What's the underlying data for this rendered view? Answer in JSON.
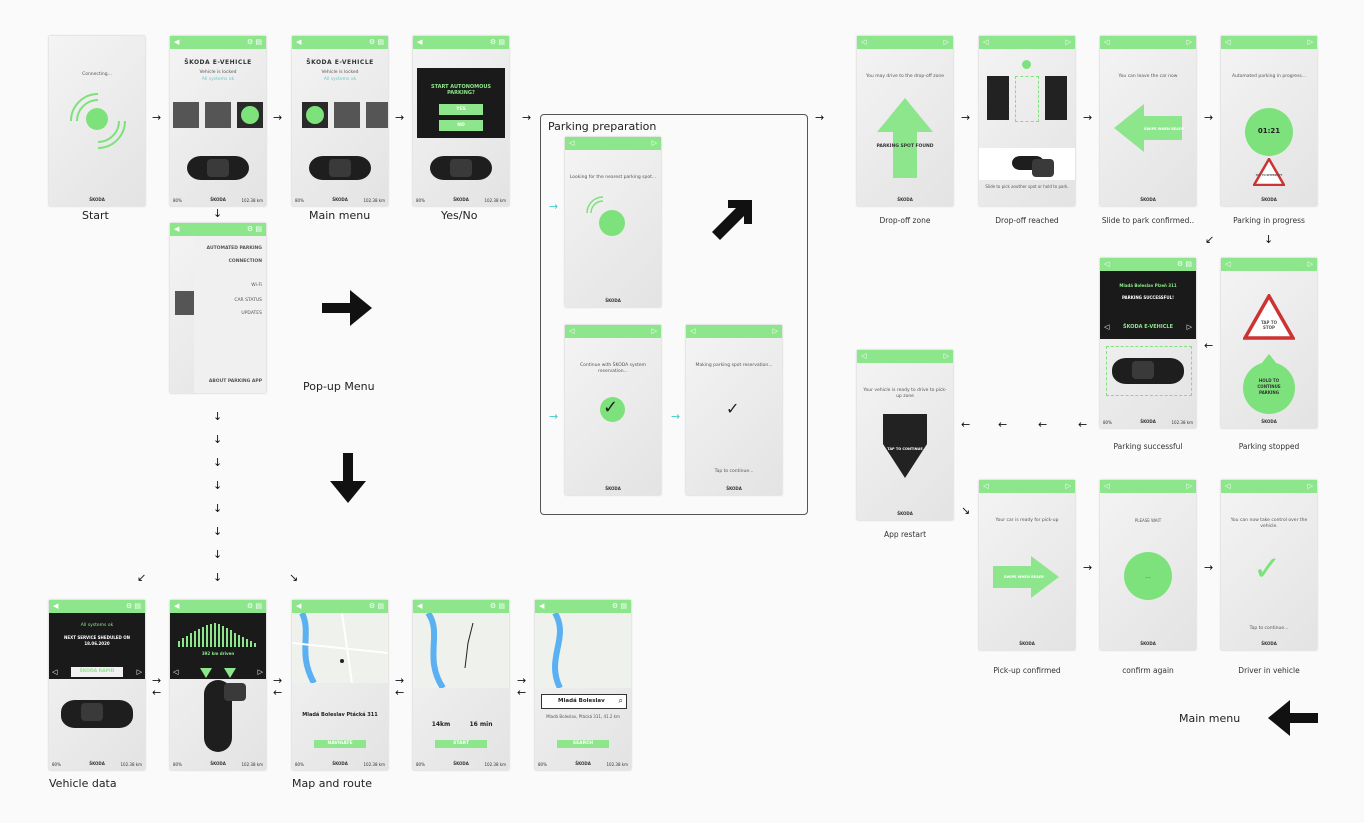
{
  "labels": {
    "start": "Start",
    "main_menu": "Main menu",
    "yes_no": "Yes/No",
    "popup_menu": "Pop-up Menu",
    "parking_preparation": "Parking preparation",
    "vehicle_data": "Vehicle data",
    "map_and_route": "Map and route",
    "main_menu_return": "Main menu",
    "drop_off_zone": "Drop-off zone",
    "drop_off_reached": "Drop-off reached",
    "slide_to_park": "Slide to park confirmed..",
    "parking_in_progress": "Parking in progress",
    "parking_successful": "Parking successful",
    "parking_stopped": "Parking stopped",
    "app_restart": "App restart",
    "pickup_confirmed": "Pick-up confirmed",
    "confirm_again": "confirm again",
    "driver_in_vehicle": "Driver in vehicle"
  },
  "screens": {
    "brand": "ŠKODA E-VEHICLE",
    "logo": "ŠKODA",
    "connecting": "Connecting...",
    "locked": "Vehicle is locked",
    "systems_ok": "All systems ok",
    "foot_left": "80%",
    "foot_right": "102.38 km",
    "start_autonomous": "START AUTONOMOUS PARKING?",
    "yes": "YES",
    "no": "NO",
    "menu_items": [
      "AUTOMATED PARKING",
      "CONNECTION",
      "Wi-Fi",
      "CAR STATUS",
      "UPDATES",
      "ABOUT PARKING APP"
    ],
    "looking": "Looking for the nearest parking spot...",
    "continue_reservation": "Continue with ŠKODA system reservation...",
    "making_reservation": "Making parking spot reservation...",
    "tap_continue": "Tap to continue...",
    "drive_to_dropoff": "You may drive to the drop-off zone",
    "parking_spot_found": "PARKING SPOT FOUND",
    "slide_to_pick": "Slide to pick another spot or hold to park.",
    "can_leave": "You can leave the car now",
    "swipe_ready": "SWIPE WHEN READY",
    "automated_in_progress": "Automated parking in progress...",
    "timer": "01:21",
    "tap_to_interrupt": "TAP TO INTERRUPT",
    "tap_to_stop": "TAP TO STOP",
    "hold_to_continue": "HOLD TO CONTINUE PARKING",
    "parking_place": "Mladá Boleslav Plzeň 311",
    "parking_successful": "PARKING SUCCESSFUL!",
    "ready_to_drive": "Your vehicle is ready to drive to pick-up zone",
    "tap_to_continue_big": "TAP TO CONTINUE",
    "ready_for_pickup": "Your car is ready for pick-up",
    "please_wait": "PLEASE WAIT",
    "take_control": "You can now take control over the vehicle.",
    "next_service": "NEXT SERVICE SHEDULED ON 18.06.2020",
    "skoda_rapid": "ŠKODA RAPID",
    "km_driven": "392 km driven",
    "address": "Mladá Boleslav Ptácká 311",
    "navigate": "NAVIGATE",
    "distance": "14km",
    "duration": "16 min",
    "start": "START",
    "search_city": "Mladá Boleslav",
    "search_result": "Mladá Boleslav, Ptácká 311, 41.2 km",
    "search": "SEARCH",
    "dots": "..."
  }
}
